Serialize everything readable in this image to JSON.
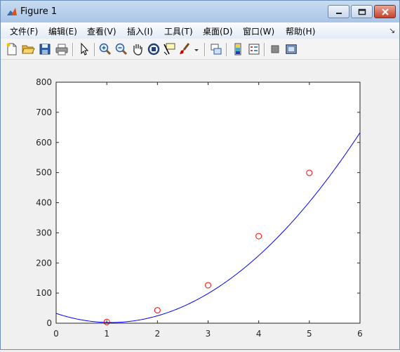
{
  "window": {
    "title": "Figure 1"
  },
  "menu": [
    "文件(F)",
    "编辑(E)",
    "查看(V)",
    "插入(I)",
    "工具(T)",
    "桌面(D)",
    "窗口(W)",
    "帮助(H)"
  ],
  "toolbar_icons": [
    "new-figure-icon",
    "open-file-icon",
    "save-icon",
    "print-icon",
    "edit-plot-arrow-icon",
    "zoom-in-icon",
    "zoom-out-icon",
    "pan-hand-icon",
    "rotate-3d-icon",
    "data-cursor-icon",
    "brush-icon",
    "brush-dropdown-icon",
    "link-plot-icon",
    "colorbar-icon",
    "legend-icon",
    "hide-plot-tools-icon",
    "show-plot-tools-icon"
  ],
  "chart_data": {
    "type": "scatter",
    "xlim": [
      0,
      6
    ],
    "ylim": [
      0,
      800
    ],
    "xticks": [
      0,
      1,
      2,
      3,
      4,
      5,
      6
    ],
    "yticks": [
      0,
      100,
      200,
      300,
      400,
      500,
      600,
      700,
      800
    ],
    "grid": false,
    "series": [
      {
        "kind": "markers",
        "marker": "circle",
        "color": "#ff0000",
        "x": [
          1,
          2,
          3,
          4,
          5
        ],
        "y": [
          4,
          43,
          126,
          289,
          499
        ]
      },
      {
        "kind": "line",
        "color": "#0000ff",
        "fit_coefficients": [
          32.5,
          -56.0,
          26.0
        ],
        "x_range": [
          0,
          6
        ]
      }
    ]
  }
}
